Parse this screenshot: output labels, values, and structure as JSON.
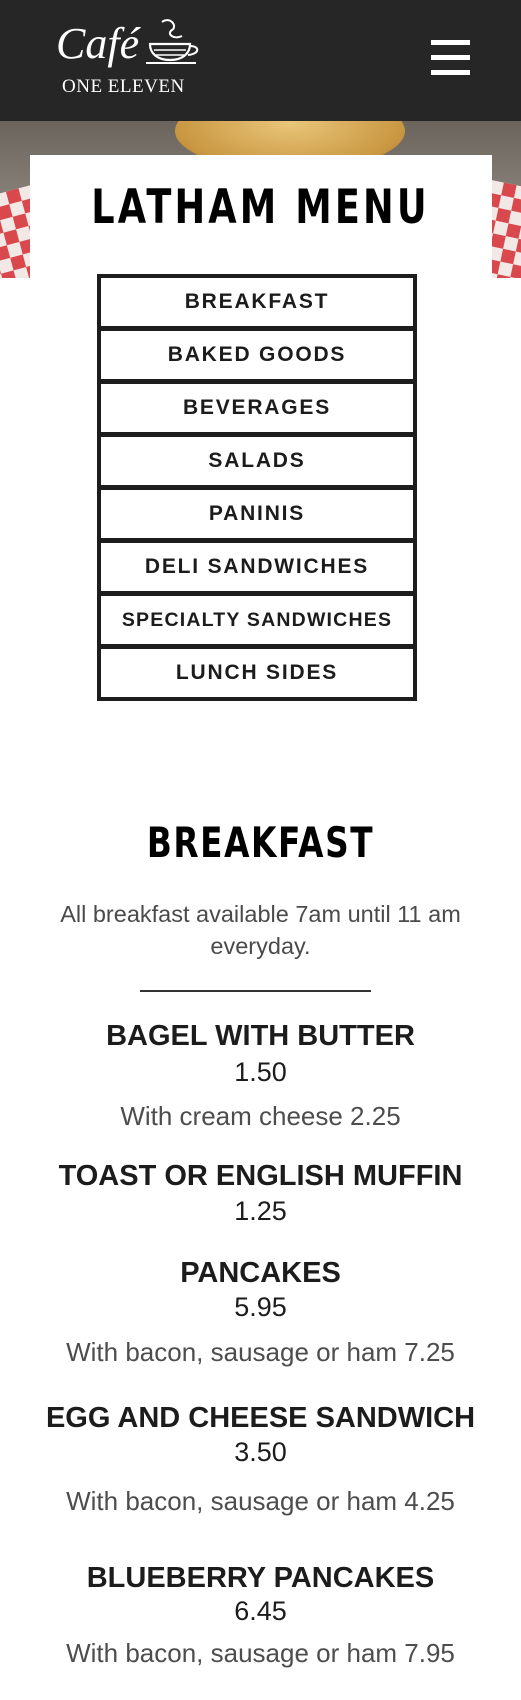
{
  "header": {
    "logo": {
      "script": "Café",
      "subtitle": "ONE ELEVEN"
    },
    "menu_icon": "hamburger-icon"
  },
  "page": {
    "title": "LATHAM MENU"
  },
  "nav": {
    "items": [
      "BREAKFAST",
      "BAKED GOODS",
      "BEVERAGES",
      "SALADS",
      "PANINIS",
      "DELI SANDWICHES",
      "SPECIALTY SANDWICHES",
      "LUNCH SIDES"
    ]
  },
  "section": {
    "title": "BREAKFAST",
    "note": "All breakfast available 7am until 11 am everyday.",
    "items": [
      {
        "name": "BAGEL WITH BUTTER",
        "price": "1.50",
        "desc": "With cream cheese 2.25"
      },
      {
        "name": "TOAST OR ENGLISH MUFFIN",
        "price": "1.25",
        "desc": ""
      },
      {
        "name": "PANCAKES",
        "price": "5.95",
        "desc": "With bacon, sausage or ham 7.25"
      },
      {
        "name": "EGG AND CHEESE SANDWICH",
        "price": "3.50",
        "desc": "With bacon, sausage or ham 4.25"
      },
      {
        "name": "BLUEBERRY PANCAKES",
        "price": "6.45",
        "desc": "With bacon, sausage or ham 7.95"
      }
    ]
  },
  "colors": {
    "header_bg": "#262626",
    "text": "#1c1c1c",
    "muted": "#4d4d4d"
  }
}
